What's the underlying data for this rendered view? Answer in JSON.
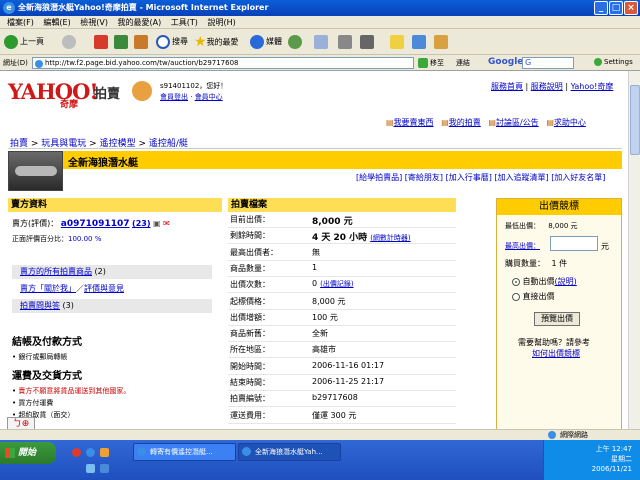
{
  "window": {
    "title": "全新海狼潛水艇Yahoo!奇摩拍賣 - Microsoft Internet Explorer",
    "min": "_",
    "max": "□",
    "close": "×"
  },
  "menu": [
    "檔案(F)",
    "編輯(E)",
    "檢視(V)",
    "我的最愛(A)",
    "工具(T)",
    "說明(H)"
  ],
  "toolbar": {
    "back": "上一頁",
    "search": "搜尋",
    "favorites": "我的最愛",
    "media": "媒體"
  },
  "address": {
    "label": "網址(D)",
    "url": "http://tw.f2.page.bid.yahoo.com/tw/auction/b29717608",
    "go": "移至",
    "links": "連結",
    "google_label": "Google",
    "google_search": "G",
    "settings": "Settings"
  },
  "site": {
    "logo_text": "YAHOO!",
    "logo_sub": "奇摩",
    "logo_section": "拍賣",
    "user_greeting": "s91401102，您好！",
    "logout": "登出",
    "member_login": "會員登出",
    "member_center": "會員中心",
    "top_links": [
      "服務首頁",
      "服務說明",
      "Yahoo!奇摩"
    ],
    "tool_links": [
      "我要賣東西",
      "我的拍賣",
      "討論區/公告",
      "求助中心"
    ]
  },
  "breadcrumb": [
    "拍賣",
    "玩具與電玩",
    "遙控模型",
    "遙控船/艇"
  ],
  "item": {
    "title": "全新海狼潛水艇",
    "actions": [
      "[給學拍賣品]",
      "[寄給朋友]",
      "[加入行事曆]",
      "[加入追蹤清單]",
      "[加入好友名單]"
    ]
  },
  "seller": {
    "header": "賣方資料",
    "label": "賣方(評價)：",
    "name": "a0971091107",
    "score": "(23)",
    "positive_label": "正面評價百分比：",
    "positive": "100.00 %",
    "links": [
      {
        "text": "賣方的所有拍賣商品",
        "count": "(2)"
      },
      {
        "text": "賣方「關於我」",
        "extra": "評價與意見"
      },
      {
        "text": "拍賣問與答",
        "count": "(3)"
      }
    ]
  },
  "payment": {
    "header": "結帳及付款方式",
    "items": [
      "銀行或郵局轉帳"
    ]
  },
  "shipping": {
    "header": "運費及交貨方式",
    "items": [
      "賣方不願意將貨品運送到其他國家。",
      "買方付運費",
      "超約取貨（面交）"
    ]
  },
  "auction": {
    "header": "拍賣檔案",
    "rows": [
      {
        "label": "目前出價：",
        "value": "8,000 元"
      },
      {
        "label": "剩餘時間：",
        "value": "4 天 20 小時",
        "extra": "(網數計時器)"
      },
      {
        "label": "最高出價者：",
        "value": "無"
      },
      {
        "label": "商品數量：",
        "value": "1"
      },
      {
        "label": "出價次數：",
        "value": "0",
        "extra": "(出價記錄)"
      },
      {
        "label": "起標價格：",
        "value": "8,000 元"
      },
      {
        "label": "出價增額：",
        "value": "100 元"
      },
      {
        "label": "商品新舊：",
        "value": "全新"
      },
      {
        "label": "所在地區：",
        "value": "高雄市"
      },
      {
        "label": "開始時間：",
        "value": "2006-11-16 01:17"
      },
      {
        "label": "結束時間：",
        "value": "2006-11-25 21:17"
      },
      {
        "label": "拍賣編號：",
        "value": "b29717608"
      },
      {
        "label": "運送費用：",
        "value": "僅運 300 元"
      }
    ]
  },
  "bid": {
    "header": "出價競標",
    "min_label": "最低出價：",
    "min_value": "8,000 元",
    "max_label": "最高出價：",
    "unit": "元",
    "qty_label": "購買數量：",
    "qty": "1 件",
    "auto_bid": "自動出價",
    "auto_help": "(說明)",
    "direct_bid": "直接出價",
    "preview": "預覽出價",
    "help_text": "需要幫助嗎？請參考",
    "help_link": "如何出價競標"
  },
  "status": {
    "zone": "網際網路"
  },
  "taskbar": {
    "start": "開始",
    "tasks": [
      "轉寄有價遙控潛艇...",
      "全新海狼潛水艇Yah..."
    ],
    "time": "上午 12:47",
    "weekday": "星期二",
    "date": "2006/11/21"
  },
  "colors": {
    "accent": "#ffcc00",
    "link": "#0000cc",
    "price_red": "#cc0000"
  }
}
